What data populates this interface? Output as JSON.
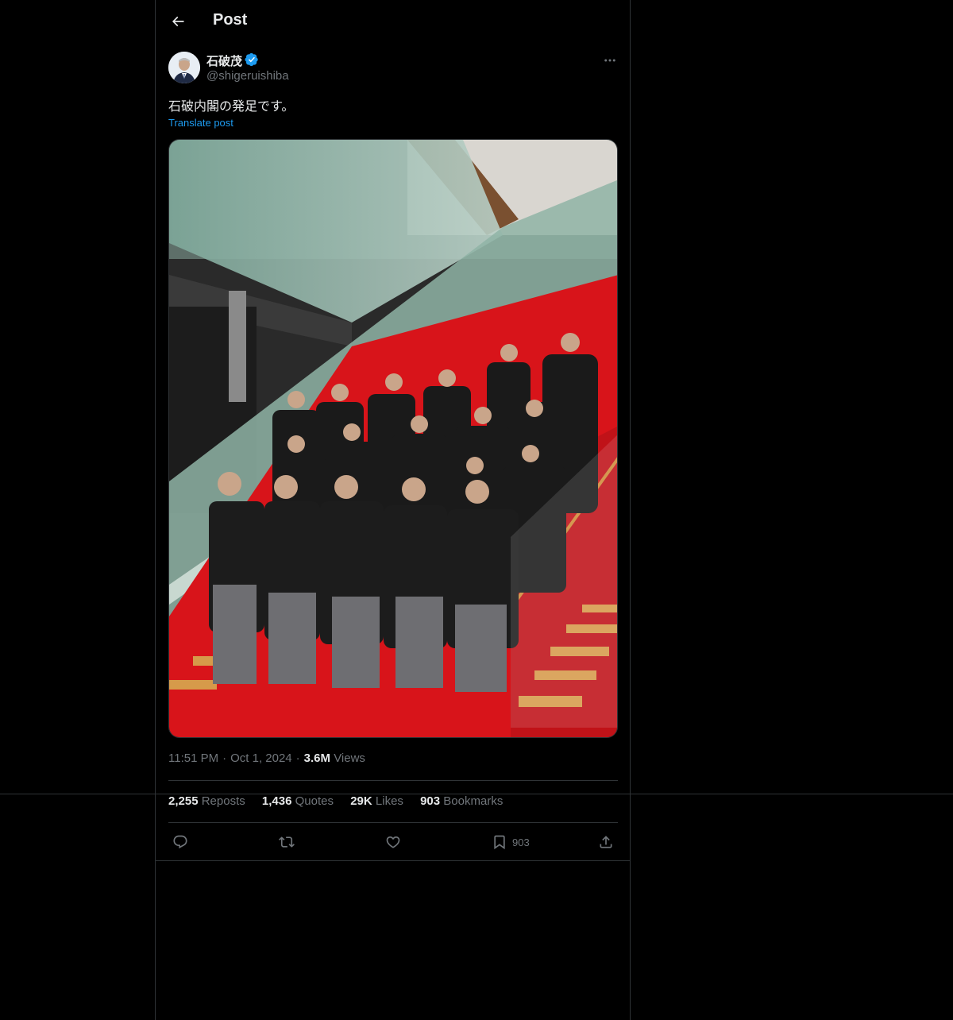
{
  "header": {
    "title": "Post",
    "back_icon": "arrow-left-icon"
  },
  "author": {
    "display_name": "石破茂",
    "handle": "@shigeruishiba",
    "verified_color": "#1d9bf0"
  },
  "post": {
    "text": "石破内閣の発足です。",
    "translate_label": "Translate post",
    "image_icon": "cabinet-group-photo"
  },
  "meta": {
    "time": "11:51 PM",
    "date": "Oct 1, 2024",
    "views_count": "3.6M",
    "views_label": "Views"
  },
  "stats": {
    "reposts_count": "2,255",
    "reposts_label": "Reposts",
    "quotes_count": "1,436",
    "quotes_label": "Quotes",
    "likes_count": "29K",
    "likes_label": "Likes",
    "bookmarks_count": "903",
    "bookmarks_label": "Bookmarks"
  },
  "actions": {
    "reply_icon": "reply-icon",
    "repost_icon": "repost-icon",
    "like_icon": "heart-icon",
    "bookmark_icon": "bookmark-icon",
    "bookmark_count": "903",
    "share_icon": "share-icon"
  },
  "colors": {
    "background": "#000000",
    "border": "#2f3336",
    "accent": "#1d9bf0",
    "muted": "#71767b",
    "text": "#e7e9ea"
  }
}
